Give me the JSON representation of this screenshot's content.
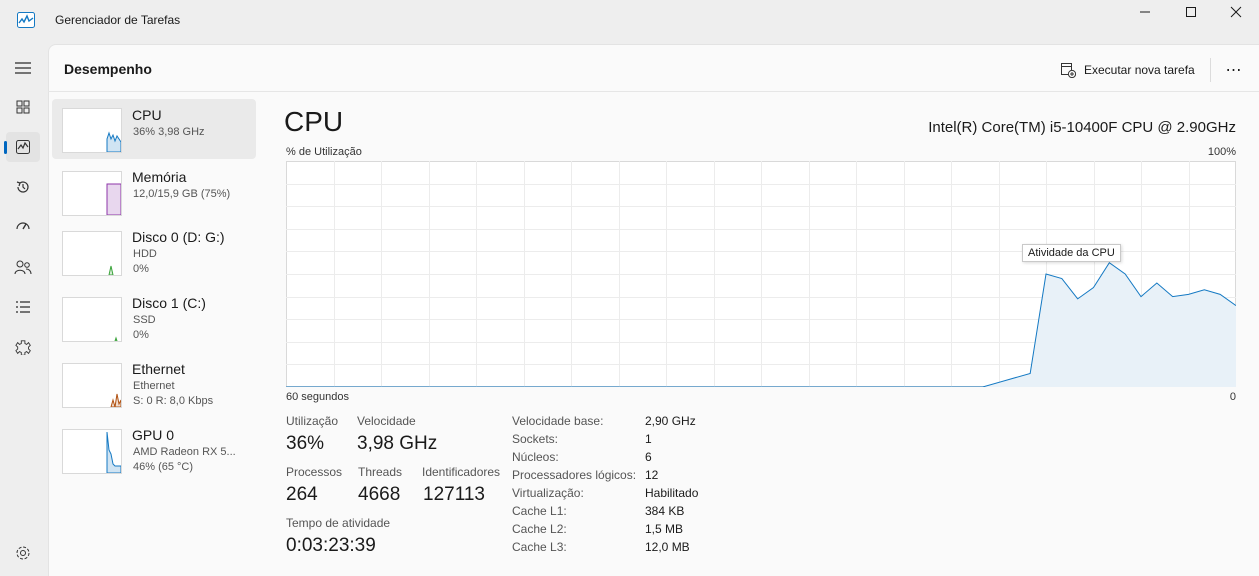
{
  "window": {
    "title": "Gerenciador de Tarefas"
  },
  "nav": {
    "items": [
      "menu-icon",
      "processes-icon",
      "performance-icon",
      "app-history-icon",
      "startup-apps-icon",
      "users-icon",
      "details-icon",
      "services-icon"
    ],
    "active": "performance-icon",
    "bottom": "settings-icon"
  },
  "header": {
    "title": "Desempenho",
    "run_task_label": "Executar nova tarefa",
    "more_label": "⋯"
  },
  "devices": [
    {
      "name": "CPU",
      "sub1": "36%  3,98 GHz",
      "sub2": "",
      "color": "#1479c3"
    },
    {
      "name": "Memória",
      "sub1": "12,0/15,9 GB (75%)",
      "sub2": "",
      "color": "#8e35a8"
    },
    {
      "name": "Disco 0 (D: G:)",
      "sub1": "HDD",
      "sub2": "0%",
      "color": "#3aa33a"
    },
    {
      "name": "Disco 1 (C:)",
      "sub1": "SSD",
      "sub2": "0%",
      "color": "#3aa33a"
    },
    {
      "name": "Ethernet",
      "sub1": "Ethernet",
      "sub2": "S: 0  R: 8,0 Kbps",
      "color": "#b05010"
    },
    {
      "name": "GPU 0",
      "sub1": "AMD Radeon RX 5...",
      "sub2": "46%  (65 °C)",
      "color": "#1479c3"
    }
  ],
  "cpu": {
    "heading": "CPU",
    "model": "Intel(R) Core(TM) i5-10400F CPU @ 2.90GHz",
    "ylabel": "% de Utilização",
    "ymax": "100%",
    "xleft": "60 segundos",
    "xright": "0",
    "tooltip": "Atividade da CPU",
    "line_color": "#1479c3",
    "fill_color": "#e8f1f8"
  },
  "chart_data": {
    "type": "area",
    "x_seconds_ago": [
      60,
      33,
      32,
      31,
      29,
      28,
      27,
      26,
      25,
      24,
      22,
      20,
      18,
      16,
      13,
      12,
      11,
      10,
      9,
      8,
      7,
      6,
      5,
      4,
      3,
      2,
      1,
      0
    ],
    "y_percent": [
      0,
      0,
      0,
      0,
      0,
      0,
      0,
      0,
      0,
      0,
      0,
      0,
      0,
      0,
      6,
      50,
      48,
      39,
      44,
      55,
      50,
      40,
      46,
      40,
      41,
      43,
      41,
      36
    ],
    "ylim": [
      0,
      100
    ],
    "xlim": [
      60,
      0
    ],
    "grid": true
  },
  "stats": {
    "util_label": "Utilização",
    "util_value": "36%",
    "speed_label": "Velocidade",
    "speed_value": "3,98 GHz",
    "proc_label": "Processos",
    "proc_value": "264",
    "threads_label": "Threads",
    "threads_value": "4668",
    "handles_label": "Identificadores",
    "handles_value": "127113",
    "uptime_label": "Tempo de atividade",
    "uptime_value": "0:03:23:39"
  },
  "specs": [
    {
      "label": "Velocidade base:",
      "value": "2,90 GHz"
    },
    {
      "label": "Sockets:",
      "value": "1"
    },
    {
      "label": "Núcleos:",
      "value": "6"
    },
    {
      "label": "Processadores lógicos:",
      "value": "12"
    },
    {
      "label": "Virtualização:",
      "value": "Habilitado"
    },
    {
      "label": "Cache L1:",
      "value": "384 KB"
    },
    {
      "label": "Cache L2:",
      "value": "1,5 MB"
    },
    {
      "label": "Cache L3:",
      "value": "12,0 MB"
    }
  ]
}
